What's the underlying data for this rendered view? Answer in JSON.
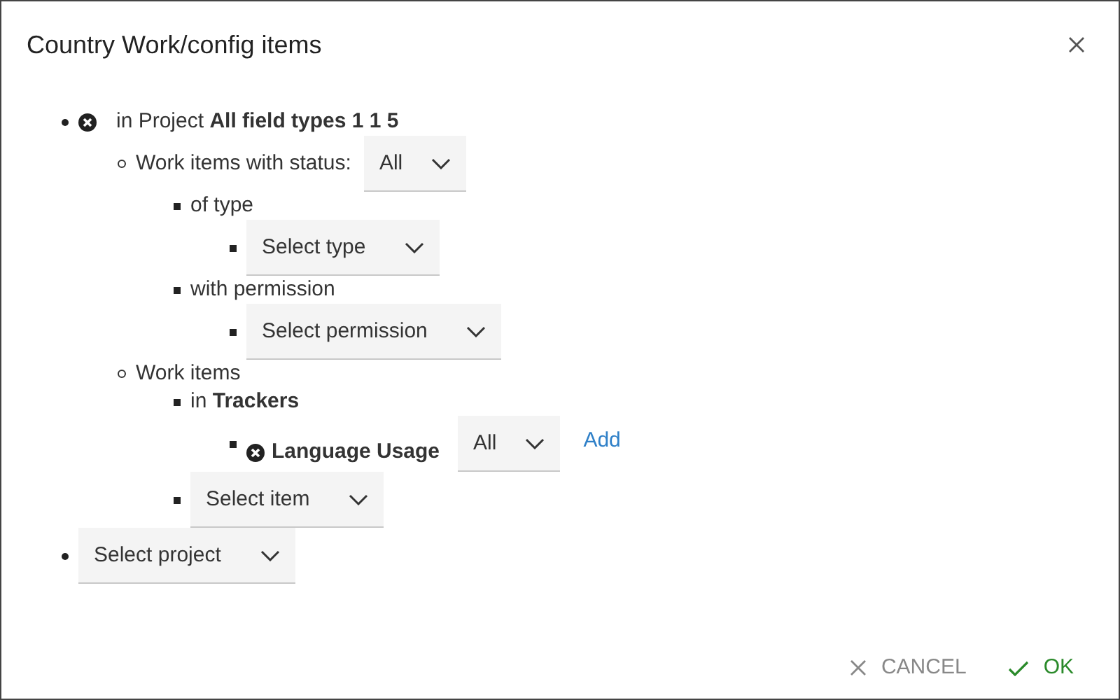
{
  "dialog": {
    "title": "Country Work/config items"
  },
  "tree": [
    {
      "kind": "project",
      "prefix": "in Project",
      "name": "All field types 1 1 5",
      "children": [
        {
          "kind": "label_select",
          "label": "Work items with status:",
          "select": "All",
          "children": [
            {
              "kind": "label",
              "label": "of type",
              "children": [
                {
                  "kind": "select",
                  "select": "Select type"
                }
              ]
            },
            {
              "kind": "label",
              "label": "with permission",
              "children": [
                {
                  "kind": "select",
                  "select": "Select permission"
                }
              ]
            }
          ]
        },
        {
          "kind": "label",
          "label": "Work items",
          "children": [
            {
              "kind": "tracker",
              "prefix": "in",
              "name": "Trackers",
              "children": [
                {
                  "kind": "item",
                  "name": "Language Usage",
                  "select": "All",
                  "link": "Add"
                }
              ]
            },
            {
              "kind": "select",
              "select": "Select item"
            }
          ]
        }
      ]
    },
    {
      "kind": "select",
      "select": "Select project"
    }
  ],
  "buttons": [
    {
      "kind": "cancel",
      "label": "CANCEL"
    },
    {
      "kind": "ok",
      "label": "OK"
    }
  ]
}
